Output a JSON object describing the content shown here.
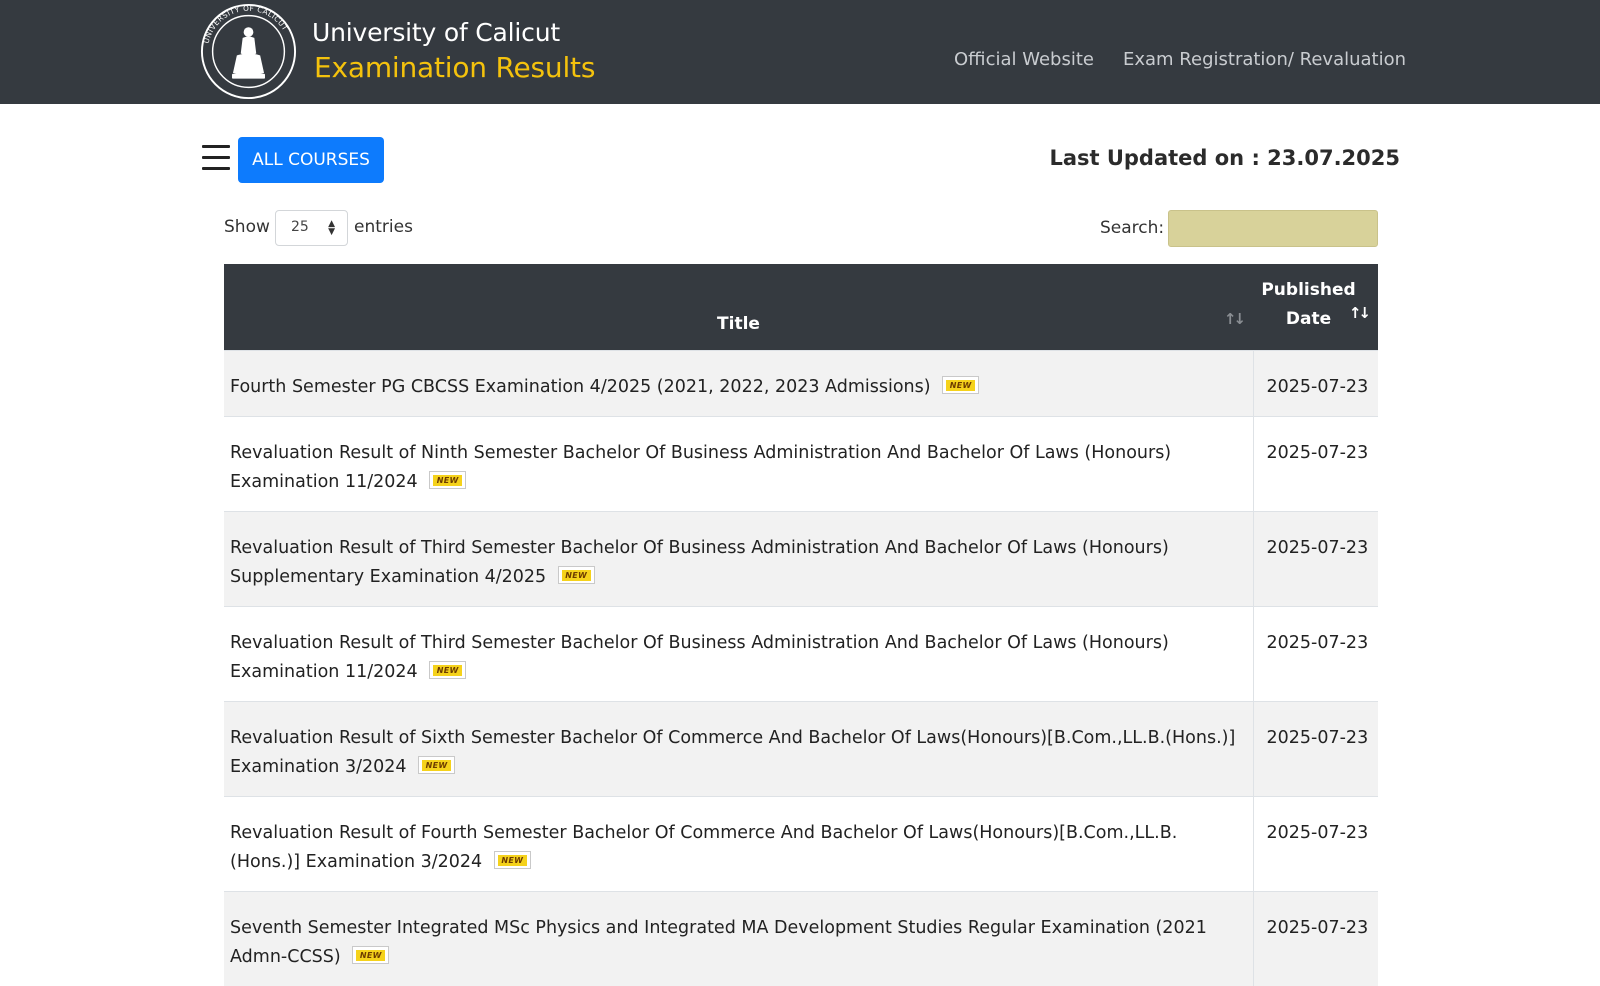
{
  "header": {
    "logo_icon": "university-seal-logo",
    "logo_ring_text": "UNIVERSITY OF CALICUT",
    "university_name": "University of Calicut",
    "site_subtitle": "Examination Results",
    "nav": {
      "official_website": "Official Website",
      "exam_registration": "Exam Registration/ Revaluation"
    },
    "colors": {
      "bar": "#353a40",
      "subtitle": "#f4c20d"
    }
  },
  "toolbar": {
    "menu_icon": "hamburger-menu-icon",
    "all_courses_label": "ALL COURSES",
    "last_updated": "Last Updated on : 23.07.2025",
    "accent": "#0d7bfd"
  },
  "controls": {
    "show_label": "Show",
    "entries_value": "25",
    "entries_label": "entries",
    "search_label": "Search:",
    "search_value": ""
  },
  "table": {
    "columns": [
      "Title",
      "Published Date"
    ],
    "date_header_line1": "Published",
    "date_header_line2": "Date",
    "badge_text": "NEW",
    "rows": [
      {
        "title": "Fourth Semester PG CBCSS Examination 4/2025 (2021, 2022, 2023 Admissions)",
        "date": "2025-07-23",
        "is_new": true
      },
      {
        "title": "Revaluation Result of Ninth Semester Bachelor Of Business Administration And Bachelor Of Laws (Honours) Examination 11/2024",
        "date": "2025-07-23",
        "is_new": true
      },
      {
        "title": "Revaluation Result of Third Semester Bachelor Of Business Administration And Bachelor Of Laws (Honours) Supplementary Examination 4/2025",
        "date": "2025-07-23",
        "is_new": true
      },
      {
        "title": "Revaluation Result of Third Semester Bachelor Of Business Administration And Bachelor Of Laws (Honours) Examination 11/2024",
        "date": "2025-07-23",
        "is_new": true
      },
      {
        "title": "Revaluation Result of Sixth Semester Bachelor Of Commerce And Bachelor Of Laws(Honours)[B.Com.,LL.B.(Hons.)] Examination 3/2024",
        "date": "2025-07-23",
        "is_new": true
      },
      {
        "title": "Revaluation Result of Fourth Semester Bachelor Of Commerce And Bachelor Of Laws(Honours)[B.Com.,LL.B.(Hons.)] Examination 3/2024",
        "date": "2025-07-23",
        "is_new": true
      },
      {
        "title": "Seventh Semester Integrated MSc Physics and Integrated MA Development Studies Regular Examination (2021 Admn-CCSS)",
        "date": "2025-07-23",
        "is_new": true
      }
    ]
  }
}
